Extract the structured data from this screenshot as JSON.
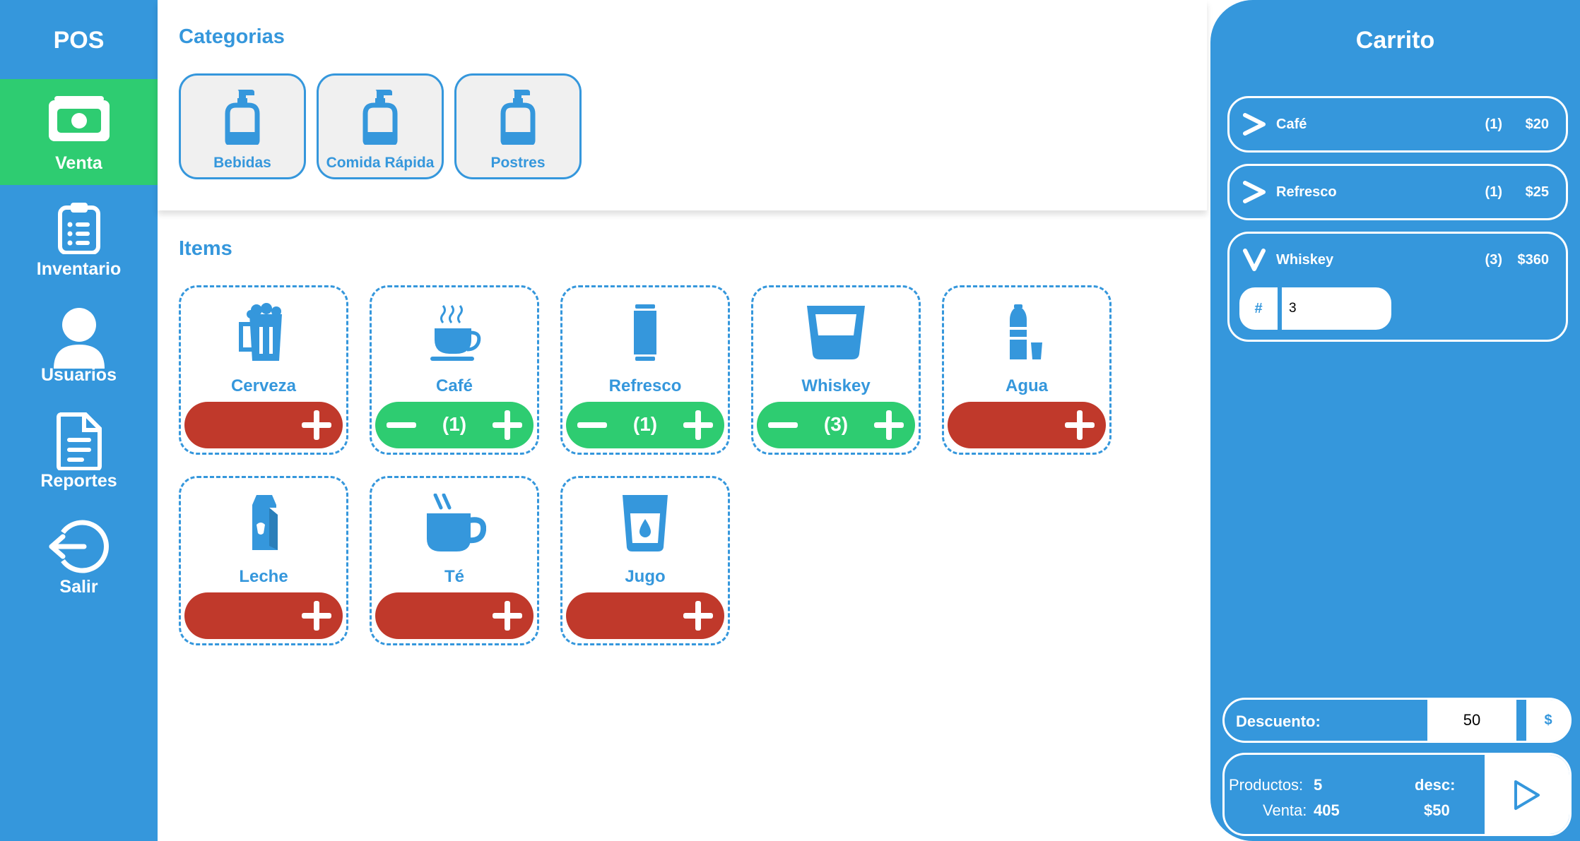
{
  "sidebar": {
    "title": "POS",
    "items": [
      {
        "label": "Venta",
        "icon": "money-icon",
        "active": true
      },
      {
        "label": "Inventario",
        "icon": "clipboard-icon",
        "active": false
      },
      {
        "label": "Usuarios",
        "icon": "user-icon",
        "active": false
      },
      {
        "label": "Reportes",
        "icon": "document-icon",
        "active": false
      },
      {
        "label": "Salir",
        "icon": "logout-icon",
        "active": false
      }
    ]
  },
  "categories": {
    "title": "Categorias",
    "items": [
      {
        "label": "Bebidas",
        "icon": "bottle-pump-icon"
      },
      {
        "label": "Comida Rápida",
        "icon": "bottle-pump-icon"
      },
      {
        "label": "Postres",
        "icon": "bottle-pump-icon"
      }
    ]
  },
  "items": {
    "title": "Items",
    "list": [
      {
        "name": "Cerveza",
        "icon": "beer-mug-icon",
        "in_cart": false,
        "qty": ""
      },
      {
        "name": "Café",
        "icon": "coffee-cup-icon",
        "in_cart": true,
        "qty": "(1)"
      },
      {
        "name": "Refresco",
        "icon": "soda-can-icon",
        "in_cart": true,
        "qty": "(1)"
      },
      {
        "name": "Whiskey",
        "icon": "whiskey-glass-icon",
        "in_cart": true,
        "qty": "(3)"
      },
      {
        "name": "Agua",
        "icon": "water-bottle-icon",
        "in_cart": false,
        "qty": ""
      },
      {
        "name": "Leche",
        "icon": "milk-carton-icon",
        "in_cart": false,
        "qty": ""
      },
      {
        "name": "Té",
        "icon": "tea-mug-icon",
        "in_cart": false,
        "qty": ""
      },
      {
        "name": "Jugo",
        "icon": "juice-glass-icon",
        "in_cart": false,
        "qty": ""
      }
    ]
  },
  "cart": {
    "title": "Carrito",
    "rows": [
      {
        "name": "Café",
        "qty": "(1)",
        "price": "$20",
        "expanded": false
      },
      {
        "name": "Refresco",
        "qty": "(1)",
        "price": "$25",
        "expanded": false
      },
      {
        "name": "Whiskey",
        "qty": "(3)",
        "price": "$360",
        "expanded": true,
        "input_prefix": "#",
        "input_value": "3"
      }
    ],
    "discount": {
      "label": "Descuento:",
      "value": "50",
      "unit": "$"
    },
    "summary": {
      "productos_label": "Productos:",
      "productos_value": "5",
      "venta_label": "Venta:",
      "venta_value": "405",
      "desc_label": "desc:",
      "desc_value": "$50"
    }
  },
  "colors": {
    "primary": "#3597dc",
    "active": "#2ecc71",
    "add": "#c0392b",
    "white": "#ffffff"
  }
}
